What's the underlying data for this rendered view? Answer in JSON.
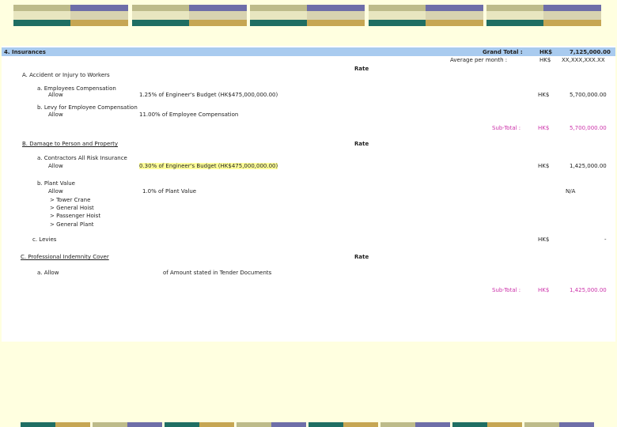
{
  "sheet": {
    "section_title": "4. Insurances",
    "grand_total_label": "Grand Total :",
    "grand_total_currency": "HK$",
    "grand_total_value": "7,125,000.00",
    "avg_label": "Average per month :",
    "avg_currency": "HK$",
    "avg_value": "XX,XXX,XXX.XX",
    "rate_header": "Rate",
    "section_a": {
      "title": "A. Accident or Injury to Workers",
      "item_a_label": "a. Employees Compensation",
      "item_a_allow": "Allow",
      "item_a_desc": "1.25% of Engineer's Budget (HK$475,000,000.00)",
      "item_a_currency": "HK$",
      "item_a_value": "5,700,000.00",
      "item_b_label": "b. Levy for Employee Compensation",
      "item_b_allow": "Allow",
      "item_b_desc": "11.00% of Employee Compensation",
      "subtotal_label": "Sub-Total :",
      "subtotal_currency": "HK$",
      "subtotal_value": "5,700,000.00"
    },
    "section_b": {
      "title": "B. Damage to Person and Property",
      "item_a_label": "a. Contractors All Risk Insurance",
      "item_a_allow": "Allow",
      "item_a_desc": "0.30% of Engineer's Budget (HK$475,000,000.00)",
      "item_a_currency": "HK$",
      "item_a_value": "1,425,000.00",
      "item_b_label": "b. Plant Value",
      "item_b_allow": "Allow",
      "item_b_desc": "1.0% of Plant Value",
      "item_b_value": "N/A",
      "plant_list": [
        "> Tower Crane",
        "> General Hoist",
        "> Passenger Hoist",
        "> General Plant"
      ],
      "item_c_label": "c. Levies",
      "item_c_currency": "HK$",
      "item_c_value": "-"
    },
    "section_c": {
      "title": "C. Professional Indemnity Cover",
      "item_a_label": "a. Allow",
      "item_a_desc": "of Amount stated in Tender Documents",
      "subtotal_label": "Sub-Total :",
      "subtotal_currency": "HK$",
      "subtotal_value": "1,425,000.00"
    }
  }
}
